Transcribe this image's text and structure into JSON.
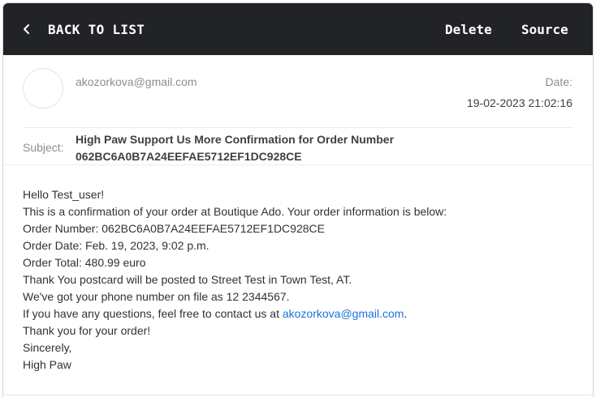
{
  "toolbar": {
    "back_label": "BACK TO LIST",
    "delete_label": "Delete",
    "source_label": "Source",
    "bg_color": "#212327"
  },
  "message": {
    "sender": "akozorkova@gmail.com",
    "date_label": "Date:",
    "date_value": "19-02-2023 21:02:16",
    "subject_label": "Subject:",
    "subject": "High Paw Support Us More Confirmation for Order Number 062BC6A0B7A24EEFAE5712EF1DC928CE"
  },
  "body": {
    "greeting": "Hello Test_user!",
    "intro": "This is a confirmation of your order at Boutique Ado. Your order information is below:",
    "order_number": "Order Number: 062BC6A0B7A24EEFAE5712EF1DC928CE",
    "order_date": "Order Date: Feb. 19, 2023, 9:02 p.m.",
    "order_total": "Order Total: 480.99 euro",
    "shipping": "Thank You postcard will be posted to Street Test in Town Test, AT.",
    "phone": "We've got your phone number on file as 12 2344567.",
    "questions_prefix": "If you have any questions, feel free to contact us at ",
    "contact_email": "akozorkova@gmail.com",
    "questions_suffix": ".",
    "thanks": "Thank you for your order!",
    "closing": "Sincerely,",
    "signature": "High Paw",
    "link_color": "#1a73d8"
  }
}
